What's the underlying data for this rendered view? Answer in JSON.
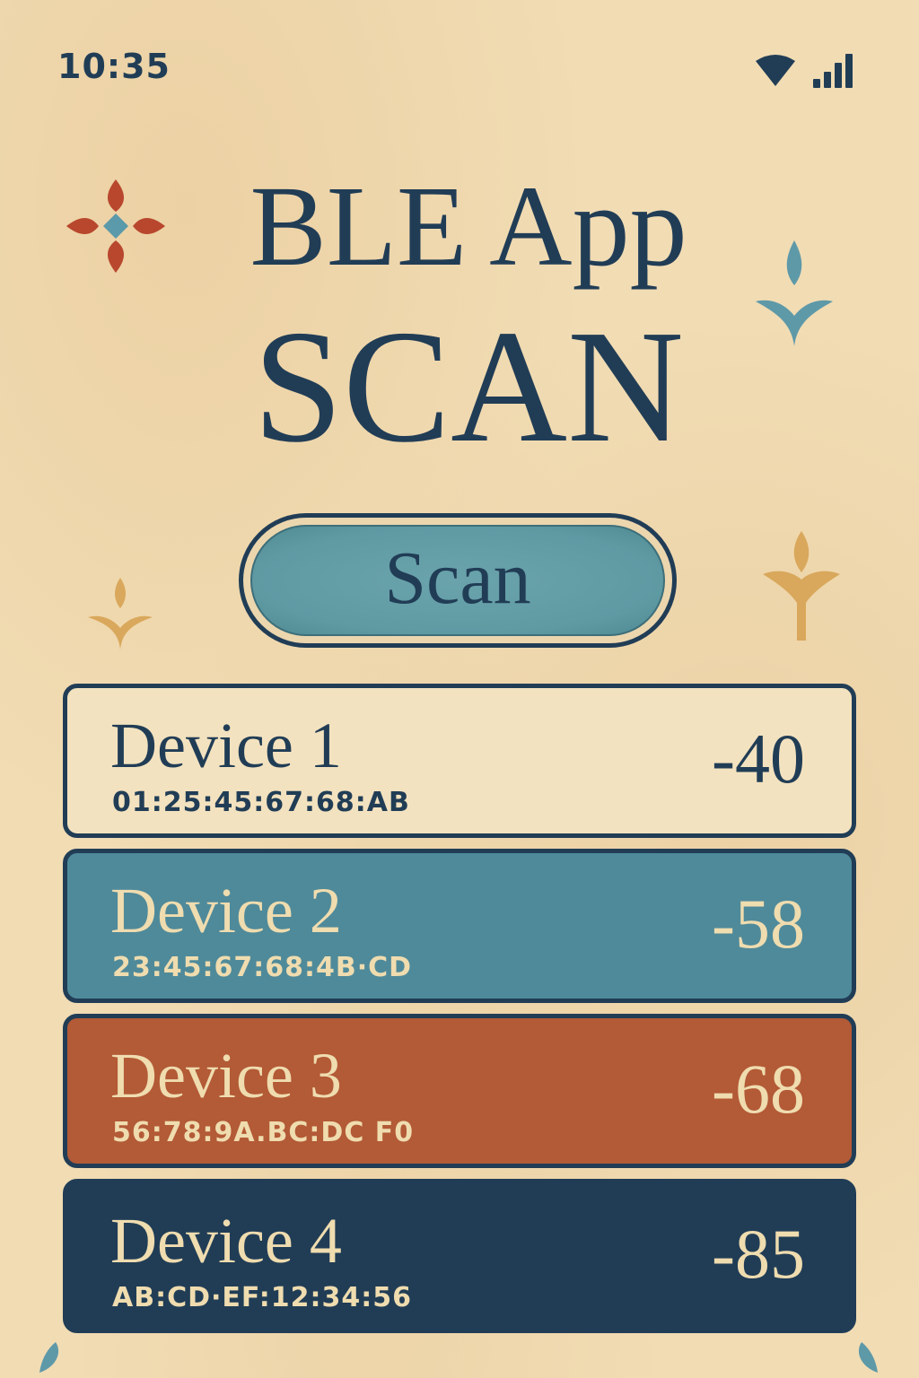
{
  "status_bar": {
    "time": "10:35",
    "icons": [
      "wifi-icon",
      "signal-icon"
    ]
  },
  "header": {
    "title_line1": "BLE App",
    "title_line2": "SCAN"
  },
  "scan_button": {
    "label": "Scan"
  },
  "devices": [
    {
      "name": "Device 1",
      "mac": "01:25:45:67:68:AB",
      "rssi": "-40"
    },
    {
      "name": "Device 2",
      "mac": "23:45:67:68:4B·CD",
      "rssi": "-58"
    },
    {
      "name": "Device 3",
      "mac": "56:78:9A.BC:DC F0",
      "rssi": "-68"
    },
    {
      "name": "Device 4",
      "mac": "AB:CD·EF:12:34:56",
      "rssi": "-85"
    }
  ],
  "colors": {
    "background": "#f1dcb4",
    "ink": "#213d56",
    "teal": "#4f8a9a",
    "terracotta": "#b35a36",
    "navy": "#213d56",
    "cream_text": "#efdcaf",
    "gold": "#d9a85c"
  }
}
